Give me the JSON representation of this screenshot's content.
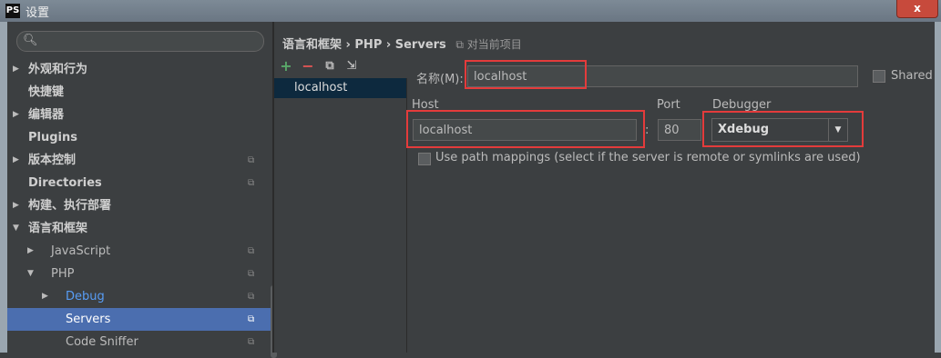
{
  "window": {
    "title": "设置",
    "logo": "PS",
    "close": "x"
  },
  "sidebar": {
    "search": {
      "placeholder": ""
    },
    "items": [
      {
        "label": "外观和行为",
        "bold": true,
        "arrow": "▶",
        "level": 0
      },
      {
        "label": "快捷键",
        "bold": true,
        "arrow": "",
        "level": 0
      },
      {
        "label": "编辑器",
        "bold": true,
        "arrow": "▶",
        "level": 0
      },
      {
        "label": "Plugins",
        "bold": true,
        "arrow": "",
        "level": 0
      },
      {
        "label": "版本控制",
        "bold": true,
        "arrow": "▶",
        "level": 0
      },
      {
        "label": "Directories",
        "bold": true,
        "arrow": "",
        "level": 0
      },
      {
        "label": "构建、执行部署",
        "bold": true,
        "arrow": "▶",
        "level": 0
      },
      {
        "label": "语言和框架",
        "bold": true,
        "arrow": "▼",
        "level": 0
      },
      {
        "label": "JavaScript",
        "bold": false,
        "arrow": "▶",
        "level": 1
      },
      {
        "label": "PHP",
        "bold": false,
        "arrow": "▼",
        "level": 1
      },
      {
        "label": "Debug",
        "bold": false,
        "arrow": "▶",
        "level": 2
      },
      {
        "label": "Servers",
        "bold": false,
        "arrow": "",
        "level": 2
      },
      {
        "label": "Code Sniffer",
        "bold": false,
        "arrow": "",
        "level": 2
      }
    ]
  },
  "content": {
    "breadcrumb": "语言和框架 › PHP › Servers",
    "project_scope": "对当前项目",
    "toolbar": {
      "add": "+",
      "remove": "−",
      "copy": "⧉",
      "import": "⇲"
    },
    "servers": [
      "localhost"
    ],
    "name_label": "名称(M):",
    "name_value": "localhost",
    "shared_label": "Shared",
    "host_label": "Host",
    "host_value": "localhost",
    "port_label": "Port",
    "port_value": "80",
    "colon": ":",
    "debugger_label": "Debugger",
    "debugger_value": "Xdebug",
    "path_mappings_label": "Use path mappings (select if the server is remote or symlinks are used)"
  },
  "colors": {
    "selection": "#4b6eaf",
    "highlight_box": "#e43b3b",
    "link": "#589df6"
  }
}
